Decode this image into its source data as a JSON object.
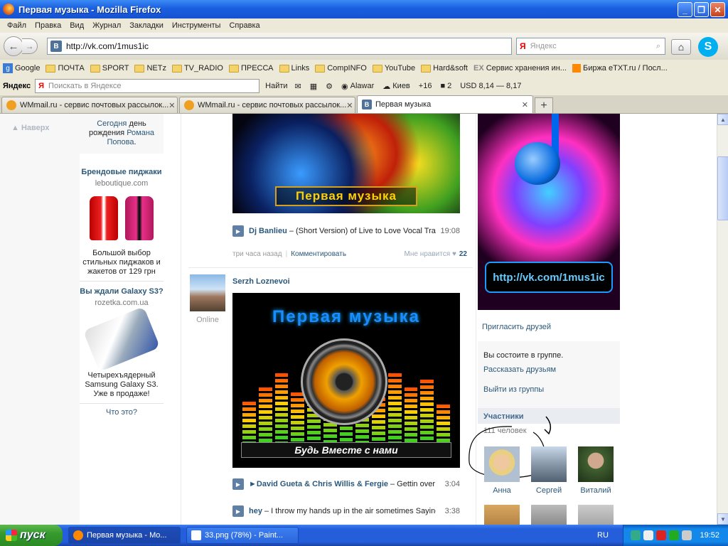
{
  "window": {
    "title": "Первая музыка - Mozilla Firefox",
    "minimize": "_",
    "maximize": "❐",
    "close": "✕"
  },
  "menu": [
    "Файл",
    "Правка",
    "Вид",
    "Журнал",
    "Закладки",
    "Инструменты",
    "Справка"
  ],
  "nav": {
    "url": "http://vk.com/1mus1ic",
    "search_placeholder": "Яндекс",
    "search_logo": "Я"
  },
  "bookmarks": [
    "Google",
    "ПОЧТА",
    "SPORT",
    "NETz",
    "TV_RADIO",
    "ПРЕССА",
    "Links",
    "CompINFO",
    "YouTube",
    "Hard&soft",
    "Сервис хранения ин...",
    "Биржа eTXT.ru / Посл..."
  ],
  "yandex_bar": {
    "logo": "Яндекс",
    "search_placeholder": "Поискать в Яндексе",
    "find": "Найти",
    "alawar": "Alawar",
    "city": "Киев",
    "temp": "+16",
    "mail_count": "2",
    "usd": "USD 8,14 — 8,17"
  },
  "tabs": [
    {
      "label": "WMmail.ru - сервис почтовых рассылок...",
      "active": false
    },
    {
      "label": "WMmail.ru - сервис почтовых рассылок...",
      "active": false
    },
    {
      "label": "Первая музыка",
      "active": true
    }
  ],
  "left": {
    "naverh": "Наверх"
  },
  "ads": {
    "bday_today": "Сегодня",
    "bday_text": "день рождения",
    "bday_name": "Романа Попова",
    "ad1_title": "Брендовые пиджаки",
    "ad1_site": "leboutique.com",
    "ad1_text": "Большой выбор стильных пиджаков и жакетов от 129 грн",
    "ad2_title": "Вы ждали Galaxy S3?",
    "ad2_site": "rozetka.com.ua",
    "ad2_text": "Четырехъядерный Samsung Galaxy S3. Уже в продаже!",
    "what": "Что это?"
  },
  "feed": {
    "post1": {
      "image_caption": "Первая музыка",
      "artist": "Dj Banlieu",
      "title": "– (Short Version) of Live to Love Vocal Track",
      "duration": "19:08",
      "time": "три часа назад",
      "comment": "Комментировать",
      "like": "Мне нравится",
      "like_count": "22"
    },
    "post2": {
      "author": "Serzh Loznevoi",
      "online": "Online",
      "image_title": "Первая музыка",
      "image_slogan": "Будь Вместе с нами",
      "tracks": [
        {
          "artist": "►David Gueta & Chris Willis & Fergie",
          "title": "– Gettin over you",
          "duration": "3:04"
        },
        {
          "artist": "hey",
          "title": "– I throw my hands up in the air sometimes Saying",
          "duration": "3:38"
        }
      ]
    }
  },
  "right": {
    "url_badge": "http://vk.com/1mus1ic",
    "invite": "Пригласить друзей",
    "member_status": "Вы состоите в группе.",
    "tell_friends": "Рассказать друзьям",
    "leave": "Выйти из группы",
    "members_title": "Участники",
    "members_count": "111 человек",
    "members": [
      {
        "name": "Анна"
      },
      {
        "name": "Сергей"
      },
      {
        "name": "Виталий"
      }
    ]
  },
  "taskbar": {
    "start": "пуск",
    "tasks": [
      "Первая музыка - Mo...",
      "33.png (78%) - Paint..."
    ],
    "lang": "RU",
    "clock": "19:52"
  }
}
